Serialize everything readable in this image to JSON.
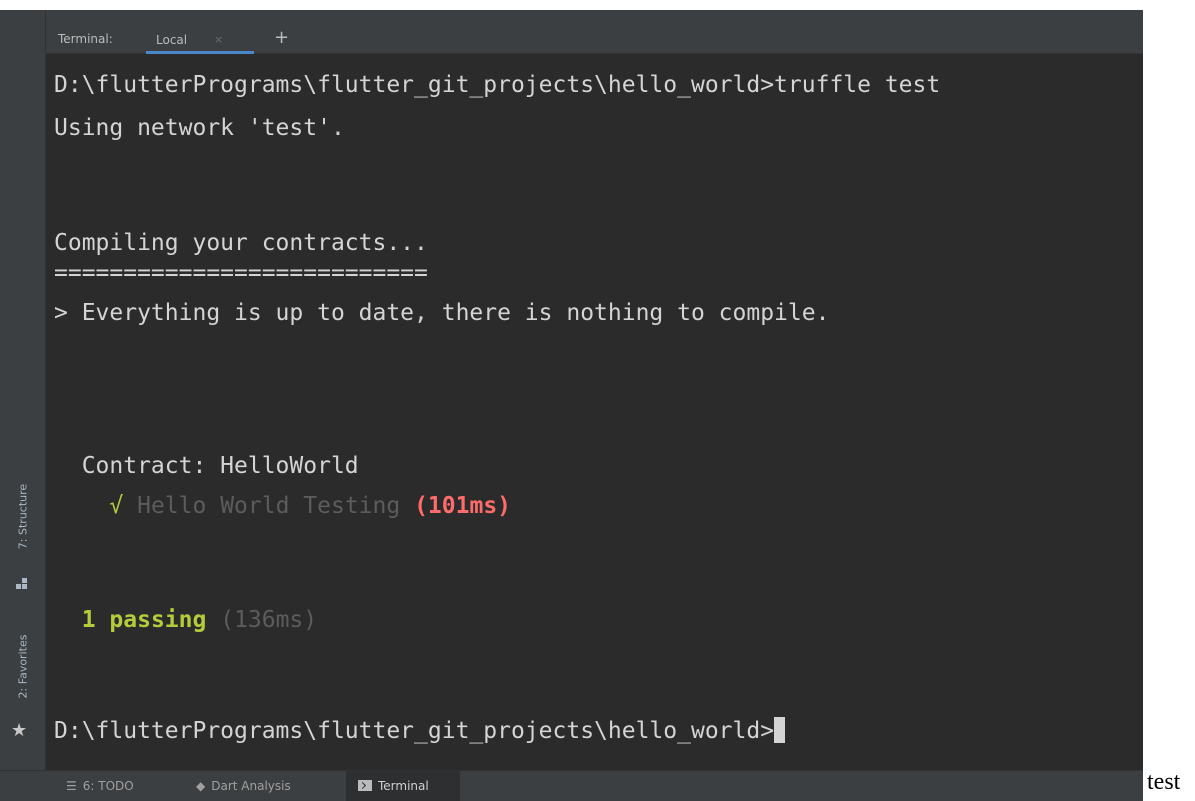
{
  "tool_window": {
    "title": "Terminal:",
    "tabs": [
      {
        "label": "Local",
        "close": "×"
      }
    ],
    "new_tab": "+"
  },
  "side_panels": {
    "structure": "7: Structure",
    "favorites": "2: Favorites"
  },
  "terminal": {
    "lines": [
      "D:\\flutterPrograms\\flutter_git_projects\\hello_world>truffle test",
      "Using network 'test'.",
      "Compiling your contracts...",
      "===========================",
      "> Everything is up to date, there is nothing to compile.",
      "  Contract: HelloWorld"
    ],
    "test_result": {
      "check": "√",
      "name": "Hello World Testing",
      "duration": "(101ms)"
    },
    "summary": {
      "passing": "1 passing",
      "duration": "(136ms)"
    },
    "prompt": "D:\\flutterPrograms\\flutter_git_projects\\hello_world>"
  },
  "bottom_tabs": [
    {
      "icon": "list-icon",
      "label": "6: TODO"
    },
    {
      "icon": "dart-icon",
      "label": "Dart Analysis"
    },
    {
      "icon": "terminal-icon",
      "label": "Terminal"
    }
  ],
  "caption": "test",
  "colors": {
    "background": "#2b2b2b",
    "text": "#d4d4d4",
    "pass_green": "#b5cc3a",
    "duration_red": "#ff6b6b",
    "dim": "#5c5c5c",
    "tab_underline": "#4a88c7"
  }
}
